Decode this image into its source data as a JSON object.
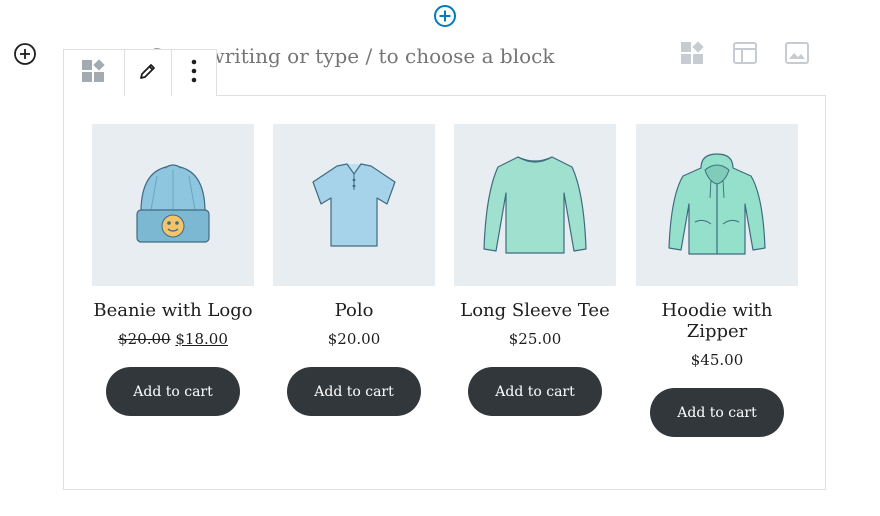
{
  "editor": {
    "placeholder": "Start writing or type / to choose a block",
    "inserter_top_icon": "plus-circle-icon",
    "inserter_left_icon": "plus-circle-icon",
    "accent_color": "#007cba",
    "quick_inserters": [
      {
        "icon": "product-blocks-icon"
      },
      {
        "icon": "layout-table-icon"
      },
      {
        "icon": "image-icon"
      }
    ]
  },
  "toolbar": {
    "switch_icon": "product-blocks-icon",
    "edit_icon": "pencil-icon",
    "more_icon": "more-vertical-icon"
  },
  "products": [
    {
      "name": "Beanie with Logo",
      "price_old": "$20.00",
      "price": "$18.00",
      "on_sale": true,
      "button": "Add to cart",
      "image": "beanie"
    },
    {
      "name": "Polo",
      "price": "$20.00",
      "on_sale": false,
      "button": "Add to cart",
      "image": "polo"
    },
    {
      "name": "Long Sleeve Tee",
      "price": "$25.00",
      "on_sale": false,
      "button": "Add to cart",
      "image": "long-sleeve-tee"
    },
    {
      "name": "Hoodie with Zipper",
      "price": "$45.00",
      "on_sale": false,
      "button": "Add to cart",
      "image": "hoodie"
    }
  ],
  "colors": {
    "button_bg": "#32373c",
    "thumb_bg": "#e8edf1",
    "beanie": "#8ec5df",
    "polo": "#a7d3ea",
    "tee": "#9fe0ce",
    "hoodie": "#94e0cb"
  }
}
